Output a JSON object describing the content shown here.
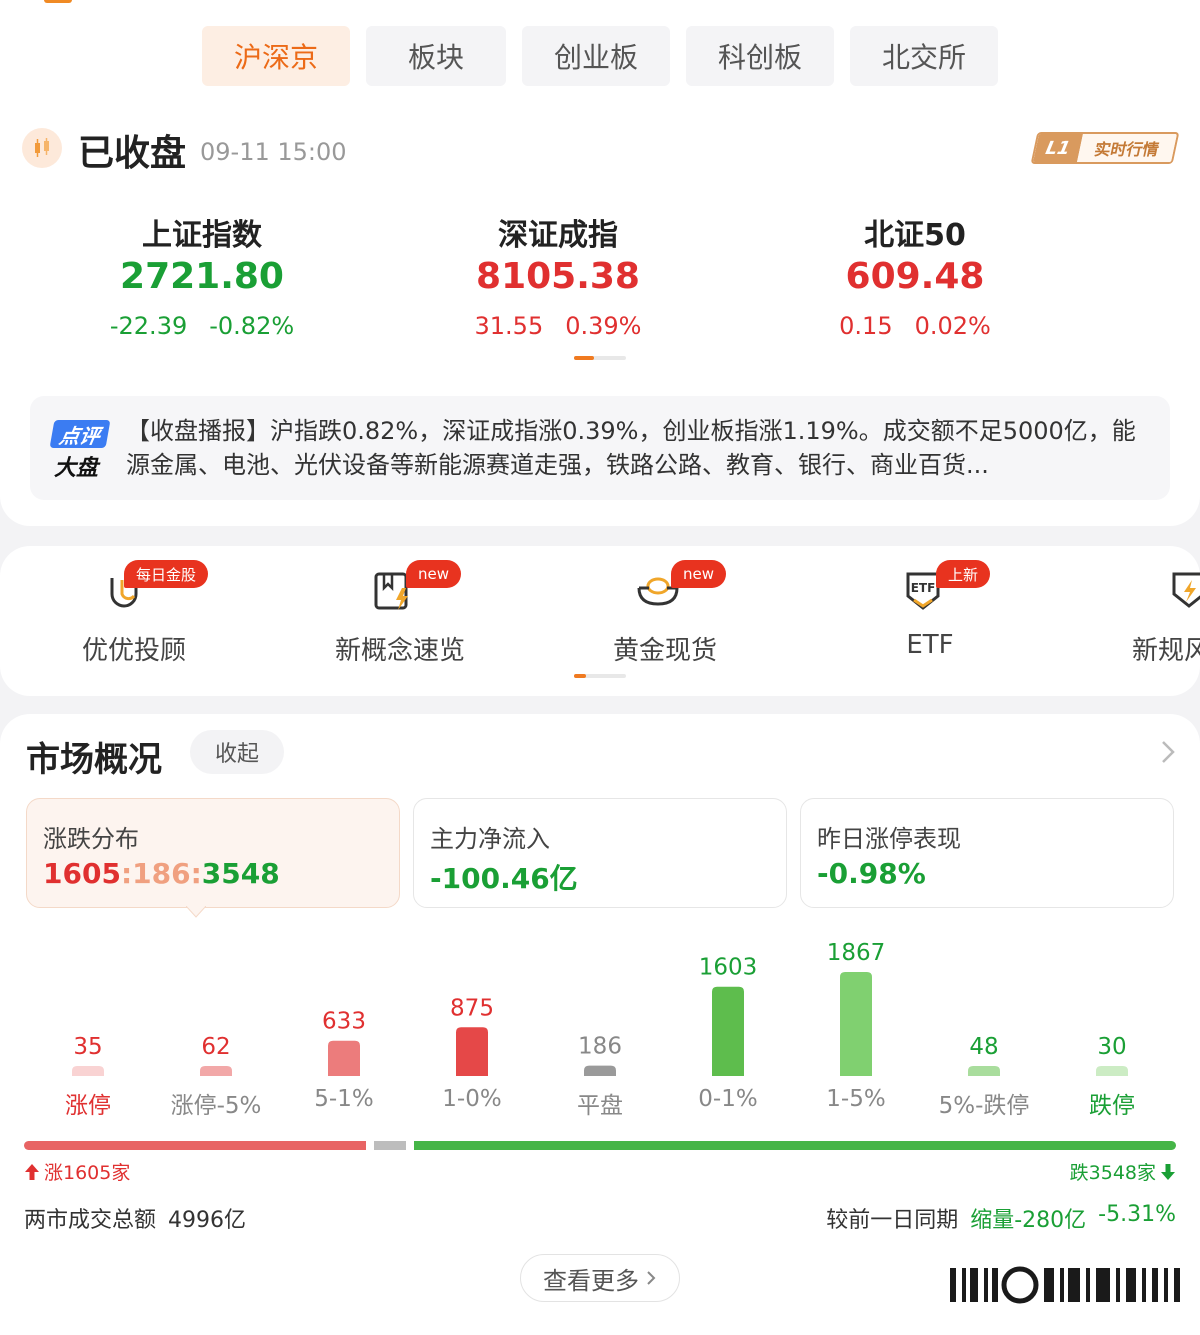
{
  "tabs": [
    {
      "label": "沪深京",
      "active": true
    },
    {
      "label": "板块",
      "active": false
    },
    {
      "label": "创业板",
      "active": false
    },
    {
      "label": "科创板",
      "active": false
    },
    {
      "label": "北交所",
      "active": false
    }
  ],
  "status": {
    "title": "已收盘",
    "time": "09-11 15:00",
    "badge_level": "L1",
    "badge_text": "实时行情"
  },
  "indices": [
    {
      "name": "上证指数",
      "value": "2721.80",
      "change": "-22.39",
      "pct": "-0.82%",
      "color": "#1a9f35"
    },
    {
      "name": "深证成指",
      "value": "8105.38",
      "change": "31.55",
      "pct": "0.39%",
      "color": "#e03030"
    },
    {
      "name": "北证50",
      "value": "609.48",
      "change": "0.15",
      "pct": "0.02%",
      "color": "#e03030"
    }
  ],
  "news": {
    "logo_top": "点评",
    "logo_bottom": "大盘",
    "text": "【收盘播报】沪指跌0.82%，深证成指涨0.39%，创业板指涨1.19%。成交额不足5000亿，能源金属、电池、光伏设备等新能源赛道走强，铁路公路、教育、银行、商业百货..."
  },
  "quick_entries": [
    {
      "label": "优优投顾",
      "badge": "每日金股",
      "icon": "advisor-icon"
    },
    {
      "label": "新概念速览",
      "badge": "new",
      "icon": "concept-book-icon"
    },
    {
      "label": "黄金现货",
      "badge": "new",
      "icon": "gold-ingot-icon"
    },
    {
      "label": "ETF",
      "badge": "上新",
      "icon": "etf-shield-icon"
    },
    {
      "label": "新规风",
      "badge": "",
      "icon": "shield-bolt-icon"
    }
  ],
  "market": {
    "title": "市场概况",
    "collapse": "收起",
    "boxes": [
      {
        "label": "涨跌分布",
        "up": "1605",
        "flat": "186",
        "down": "3548",
        "sep": ":"
      },
      {
        "label": "主力净流入",
        "value": "-100.46亿"
      },
      {
        "label": "昨日涨停表现",
        "value": "-0.98%"
      }
    ],
    "distribution": {
      "labels": [
        "涨停",
        "涨停-5%",
        "5-1%",
        "1-0%",
        "平盘",
        "0-1%",
        "1-5%",
        "5%-跌停",
        "跌停"
      ],
      "values": [
        35,
        62,
        633,
        875,
        186,
        1603,
        1867,
        48,
        30
      ],
      "colors": [
        "#f9d3d3",
        "#f2a8a8",
        "#ec7c7c",
        "#e54848",
        "#9a9a9a",
        "#5ebd4d",
        "#80d070",
        "#a9dd9d",
        "#ccecc4"
      ],
      "label_colors": [
        "#e03030",
        "#e03030",
        "#e03030",
        "#e03030",
        "#888888",
        "#1a9f35",
        "#1a9f35",
        "#1a9f35",
        "#1a9f35"
      ]
    },
    "breadth": {
      "up": 1605,
      "flat": 186,
      "down": 3548,
      "up_text": "涨1605家",
      "down_text": "跌3548家"
    },
    "turnover_label": "两市成交总额",
    "turnover_value": "4996亿",
    "compare_label": "较前一日同期",
    "compare_value": "缩量-280亿",
    "compare_pct": "-5.31%",
    "more": "查看更多"
  }
}
